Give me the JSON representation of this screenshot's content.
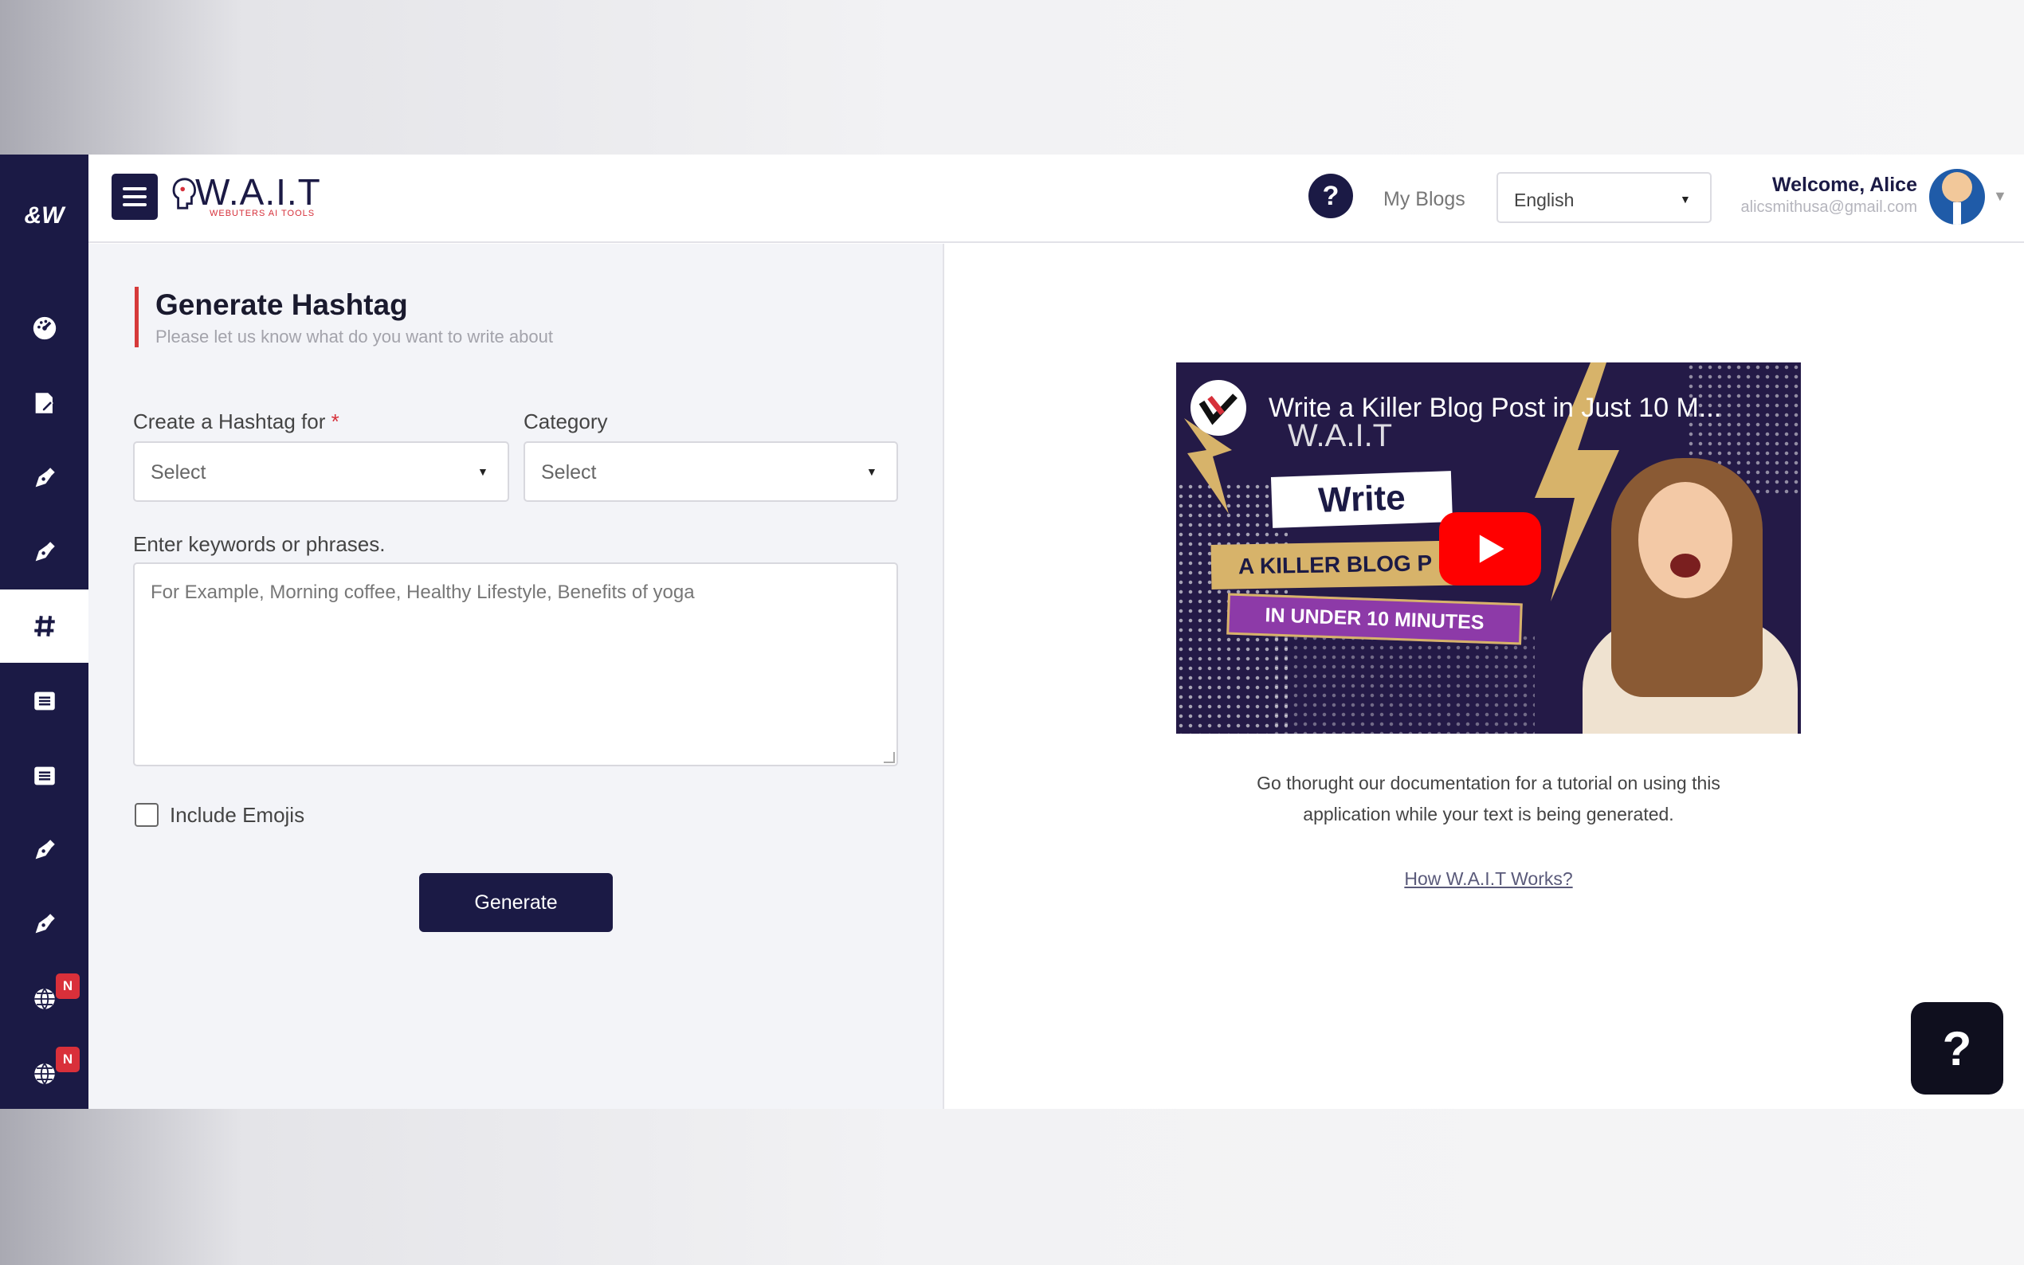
{
  "sidebar": {
    "logo": "&W",
    "items": [
      {
        "name": "dashboard",
        "icon": "dashboard-icon"
      },
      {
        "name": "edit-document",
        "icon": "edit-document-icon"
      },
      {
        "name": "pen-tool-1",
        "icon": "pen-nib-icon"
      },
      {
        "name": "pen-tool-2",
        "icon": "pen-nib-icon"
      },
      {
        "name": "hashtag",
        "icon": "hashtag-icon",
        "active": true
      },
      {
        "name": "list-1",
        "icon": "list-icon"
      },
      {
        "name": "list-2",
        "icon": "list-icon"
      },
      {
        "name": "pen-tool-3",
        "icon": "pen-nib-icon"
      },
      {
        "name": "pen-tool-4",
        "icon": "pen-nib-icon"
      },
      {
        "name": "globe-1",
        "icon": "globe-icon",
        "badge": "N"
      },
      {
        "name": "globe-2",
        "icon": "globe-icon",
        "badge": "N"
      }
    ]
  },
  "header": {
    "brand": "W.A.I.T",
    "brand_sub": "WEBUTERS AI TOOLS",
    "help_label": "?",
    "my_blogs": "My Blogs",
    "language": "English",
    "welcome": "Welcome, Alice",
    "email": "alicsmithusa@gmail.com"
  },
  "form": {
    "title": "Generate Hashtag",
    "subtitle": "Please let us know what do you want to write about",
    "hashtag_for_label": "Create a Hashtag for",
    "required_mark": "*",
    "hashtag_for_value": "Select",
    "category_label": "Category",
    "category_value": "Select",
    "keywords_label": "Enter keywords or phrases.",
    "keywords_placeholder": "For Example, Morning coffee, Healthy Lifestyle, Benefits of yoga",
    "include_emojis": "Include Emojis",
    "include_emojis_checked": false,
    "generate": "Generate"
  },
  "video": {
    "title": "Write a Killer Blog Post in Just 10 M...",
    "thumb_brand": "W.A.I.T",
    "tag_write": "Write",
    "tag_killer": "A KILLER BLOG P",
    "tag_minutes": "IN UNDER 10 MINUTES"
  },
  "info": {
    "description": "Go thorught our documentation for a tutorial on using this application while your text is being generated.",
    "link": "How W.A.I.T Works?"
  },
  "help_fab": "?",
  "colors": {
    "navy": "#1b1a45",
    "accent_red": "#d6303a",
    "youtube_red": "#ff0000"
  }
}
